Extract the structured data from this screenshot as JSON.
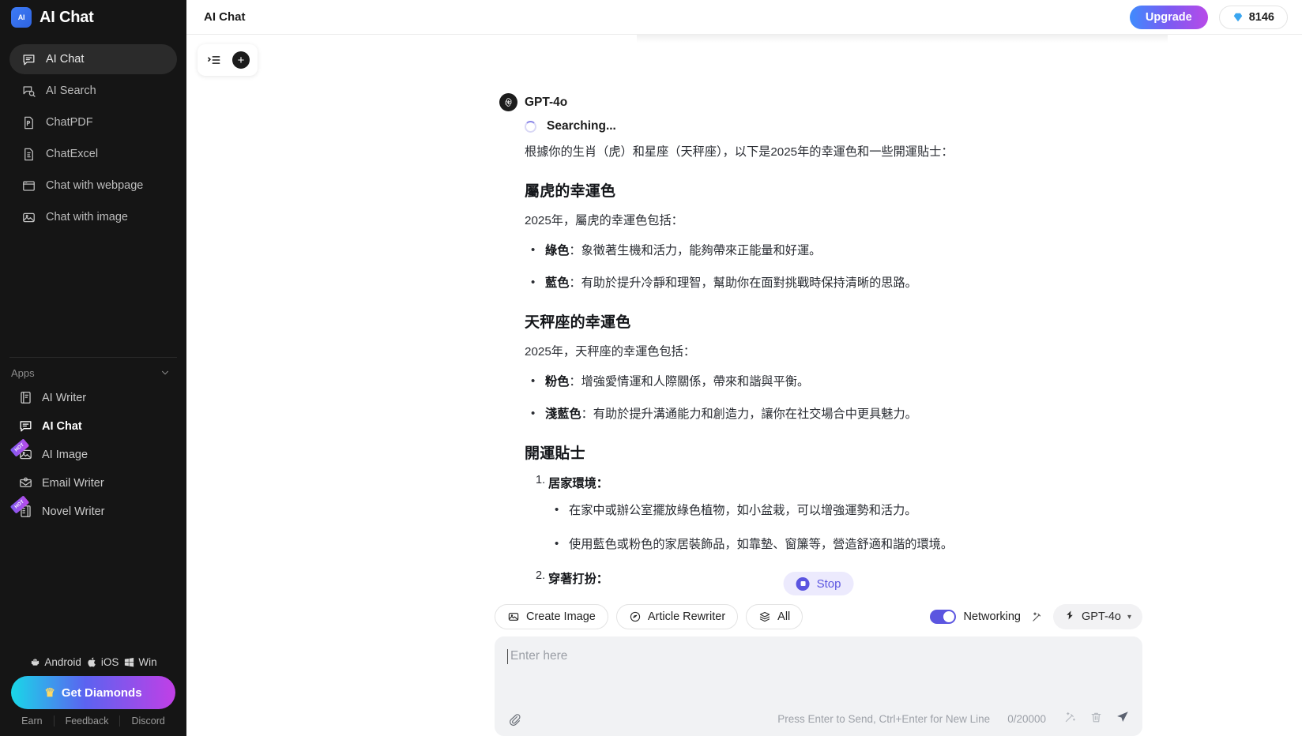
{
  "sidebar": {
    "brand": {
      "logo_text": "AI",
      "title": "AI Chat"
    },
    "nav": [
      {
        "label": "AI Chat",
        "icon": "chat-bubble-icon",
        "active": true
      },
      {
        "label": "AI Search",
        "icon": "search-chat-icon",
        "active": false
      },
      {
        "label": "ChatPDF",
        "icon": "pdf-file-icon",
        "active": false
      },
      {
        "label": "ChatExcel",
        "icon": "excel-file-icon",
        "active": false
      },
      {
        "label": "Chat with webpage",
        "icon": "browser-window-icon",
        "active": false
      },
      {
        "label": "Chat with image",
        "icon": "image-icon",
        "active": false
      }
    ],
    "apps_section": {
      "label": "Apps",
      "chevron": "chevron-down-icon"
    },
    "apps": [
      {
        "label": "AI Writer",
        "icon": "document-pen-icon",
        "badge": ""
      },
      {
        "label": "AI Chat",
        "icon": "chat-bubble-icon",
        "badge": ""
      },
      {
        "label": "AI Image",
        "icon": "image-icon",
        "badge": "HOT"
      },
      {
        "label": "Email Writer",
        "icon": "envelope-icon",
        "badge": ""
      },
      {
        "label": "Novel Writer",
        "icon": "book-icon",
        "badge": "HOT"
      }
    ],
    "platforms": [
      {
        "label": "Android",
        "icon": "android-icon"
      },
      {
        "label": "iOS",
        "icon": "apple-icon"
      },
      {
        "label": "Win",
        "icon": "windows-icon"
      }
    ],
    "get_diamonds": {
      "label": "Get Diamonds",
      "icon": "crown-icon"
    },
    "footer_links": [
      "Earn",
      "Feedback",
      "Discord"
    ]
  },
  "topbar": {
    "title": "AI Chat",
    "upgrade_label": "Upgrade",
    "diamond_count": "8146",
    "diamond_icon": "diamond-icon"
  },
  "float_toolbar": {
    "history_icon": "history-list-icon",
    "new_chat_icon": "plus-icon",
    "plus_label": "+"
  },
  "message": {
    "model": "GPT-4o",
    "avatar_icon": "openai-logo-icon",
    "status": "Searching...",
    "intro": "根據你的生肖（虎）和星座（天秤座），以下是2025年的幸運色和一些開運貼士：",
    "sections": [
      {
        "heading": "屬虎的幸運色",
        "lead": "2025年，屬虎的幸運色包括：",
        "bullets": [
          {
            "term": "綠色",
            "text": "：象徵著生機和活力，能夠帶來正能量和好運。"
          },
          {
            "term": "藍色",
            "text": "：有助於提升冷靜和理智，幫助你在面對挑戰時保持清晰的思路。"
          }
        ]
      },
      {
        "heading": "天秤座的幸運色",
        "lead": "2025年，天秤座的幸運色包括：",
        "bullets": [
          {
            "term": "粉色",
            "text": "：增強愛情運和人際關係，帶來和諧與平衡。"
          },
          {
            "term": "淺藍色",
            "text": "：有助於提升溝通能力和創造力，讓你在社交場合中更具魅力。"
          }
        ]
      }
    ],
    "tips": {
      "heading": "開運貼士",
      "items": [
        {
          "title": "居家環境：",
          "subs": [
            "在家中或辦公室擺放綠色植物，如小盆栽，可以增強運勢和活力。",
            "使用藍色或粉色的家居裝飾品，如靠墊、窗簾等，營造舒適和諧的環境。"
          ]
        },
        {
          "title": "穿著打扮：",
          "subs": []
        }
      ]
    }
  },
  "composer": {
    "stop_label": "Stop",
    "stop_icon": "stop-circle-icon",
    "chips": [
      {
        "label": "Create Image",
        "icon": "image-icon"
      },
      {
        "label": "Article Rewriter",
        "icon": "rewrite-icon"
      },
      {
        "label": "All",
        "icon": "layers-icon"
      }
    ],
    "networking_label": "Networking",
    "networking_on": true,
    "magic_icon": "magic-wand-icon",
    "model_label": "GPT-4o",
    "model_icon": "bolt-icon",
    "model_caret": "▾",
    "input_placeholder": "Enter here",
    "input_value": "",
    "attach_icon": "paperclip-icon",
    "hint": "Press Enter to Send, Ctrl+Enter for New Line",
    "counter": "0/20000",
    "footer_icons": [
      "magic-wand-icon",
      "trash-icon",
      "send-icon"
    ]
  },
  "colors": {
    "sidebar_bg": "#151515",
    "accent_purple": "#5b55e0",
    "upgrade_gradient_start": "#3f8bfd",
    "upgrade_gradient_end": "#b84ae8",
    "diamond_blue": "#3aa6f0"
  }
}
